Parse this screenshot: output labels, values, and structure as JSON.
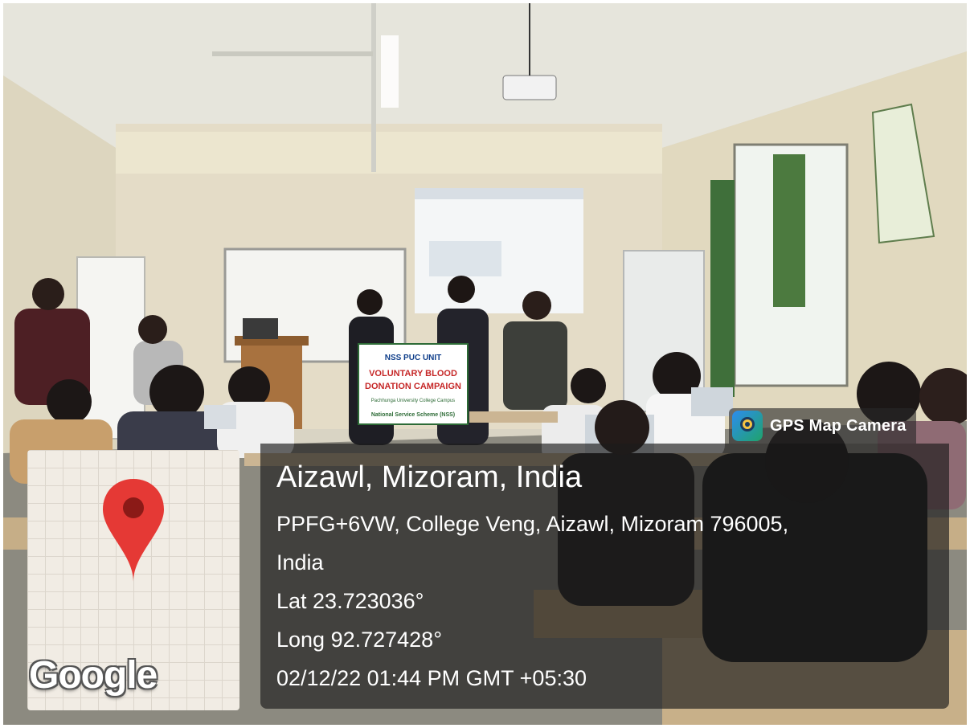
{
  "banner": {
    "line1": "NSS PUC UNIT",
    "line2": "VOLUNTARY BLOOD",
    "line3": "DONATION CAMPAIGN",
    "line4": "Pachhunga University College Campus",
    "line5": "National Service Scheme (NSS)"
  },
  "app": {
    "name": "GPS Map Camera",
    "icon": "gps-map-camera-icon"
  },
  "map": {
    "logo_text": "Google",
    "pin_icon": "map-pin-icon",
    "pin_color": "#e53935"
  },
  "location": {
    "city": "Aizawl, Mizoram, India",
    "address_line1": "PPFG+6VW, College Veng, Aizawl, Mizoram 796005,",
    "address_line2": "India",
    "lat": "Lat 23.723036°",
    "long": "Long 92.727428°",
    "timestamp": "02/12/22 01:44 PM GMT +05:30"
  }
}
